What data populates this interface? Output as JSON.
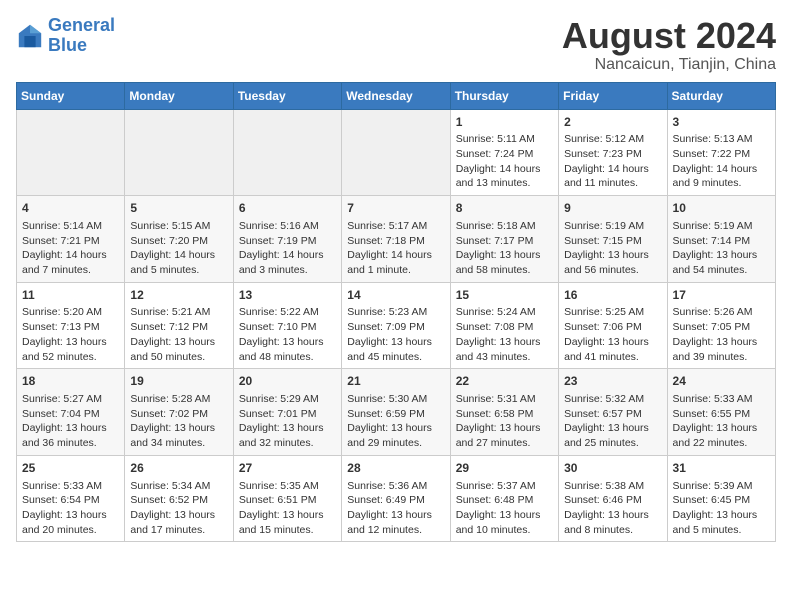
{
  "logo": {
    "text_general": "General",
    "text_blue": "Blue"
  },
  "title": "August 2024",
  "subtitle": "Nancaicun, Tianjin, China",
  "weekdays": [
    "Sunday",
    "Monday",
    "Tuesday",
    "Wednesday",
    "Thursday",
    "Friday",
    "Saturday"
  ],
  "weeks": [
    [
      {
        "day": "",
        "info": ""
      },
      {
        "day": "",
        "info": ""
      },
      {
        "day": "",
        "info": ""
      },
      {
        "day": "",
        "info": ""
      },
      {
        "day": "1",
        "info": "Sunrise: 5:11 AM\nSunset: 7:24 PM\nDaylight: 14 hours\nand 13 minutes."
      },
      {
        "day": "2",
        "info": "Sunrise: 5:12 AM\nSunset: 7:23 PM\nDaylight: 14 hours\nand 11 minutes."
      },
      {
        "day": "3",
        "info": "Sunrise: 5:13 AM\nSunset: 7:22 PM\nDaylight: 14 hours\nand 9 minutes."
      }
    ],
    [
      {
        "day": "4",
        "info": "Sunrise: 5:14 AM\nSunset: 7:21 PM\nDaylight: 14 hours\nand 7 minutes."
      },
      {
        "day": "5",
        "info": "Sunrise: 5:15 AM\nSunset: 7:20 PM\nDaylight: 14 hours\nand 5 minutes."
      },
      {
        "day": "6",
        "info": "Sunrise: 5:16 AM\nSunset: 7:19 PM\nDaylight: 14 hours\nand 3 minutes."
      },
      {
        "day": "7",
        "info": "Sunrise: 5:17 AM\nSunset: 7:18 PM\nDaylight: 14 hours\nand 1 minute."
      },
      {
        "day": "8",
        "info": "Sunrise: 5:18 AM\nSunset: 7:17 PM\nDaylight: 13 hours\nand 58 minutes."
      },
      {
        "day": "9",
        "info": "Sunrise: 5:19 AM\nSunset: 7:15 PM\nDaylight: 13 hours\nand 56 minutes."
      },
      {
        "day": "10",
        "info": "Sunrise: 5:19 AM\nSunset: 7:14 PM\nDaylight: 13 hours\nand 54 minutes."
      }
    ],
    [
      {
        "day": "11",
        "info": "Sunrise: 5:20 AM\nSunset: 7:13 PM\nDaylight: 13 hours\nand 52 minutes."
      },
      {
        "day": "12",
        "info": "Sunrise: 5:21 AM\nSunset: 7:12 PM\nDaylight: 13 hours\nand 50 minutes."
      },
      {
        "day": "13",
        "info": "Sunrise: 5:22 AM\nSunset: 7:10 PM\nDaylight: 13 hours\nand 48 minutes."
      },
      {
        "day": "14",
        "info": "Sunrise: 5:23 AM\nSunset: 7:09 PM\nDaylight: 13 hours\nand 45 minutes."
      },
      {
        "day": "15",
        "info": "Sunrise: 5:24 AM\nSunset: 7:08 PM\nDaylight: 13 hours\nand 43 minutes."
      },
      {
        "day": "16",
        "info": "Sunrise: 5:25 AM\nSunset: 7:06 PM\nDaylight: 13 hours\nand 41 minutes."
      },
      {
        "day": "17",
        "info": "Sunrise: 5:26 AM\nSunset: 7:05 PM\nDaylight: 13 hours\nand 39 minutes."
      }
    ],
    [
      {
        "day": "18",
        "info": "Sunrise: 5:27 AM\nSunset: 7:04 PM\nDaylight: 13 hours\nand 36 minutes."
      },
      {
        "day": "19",
        "info": "Sunrise: 5:28 AM\nSunset: 7:02 PM\nDaylight: 13 hours\nand 34 minutes."
      },
      {
        "day": "20",
        "info": "Sunrise: 5:29 AM\nSunset: 7:01 PM\nDaylight: 13 hours\nand 32 minutes."
      },
      {
        "day": "21",
        "info": "Sunrise: 5:30 AM\nSunset: 6:59 PM\nDaylight: 13 hours\nand 29 minutes."
      },
      {
        "day": "22",
        "info": "Sunrise: 5:31 AM\nSunset: 6:58 PM\nDaylight: 13 hours\nand 27 minutes."
      },
      {
        "day": "23",
        "info": "Sunrise: 5:32 AM\nSunset: 6:57 PM\nDaylight: 13 hours\nand 25 minutes."
      },
      {
        "day": "24",
        "info": "Sunrise: 5:33 AM\nSunset: 6:55 PM\nDaylight: 13 hours\nand 22 minutes."
      }
    ],
    [
      {
        "day": "25",
        "info": "Sunrise: 5:33 AM\nSunset: 6:54 PM\nDaylight: 13 hours\nand 20 minutes."
      },
      {
        "day": "26",
        "info": "Sunrise: 5:34 AM\nSunset: 6:52 PM\nDaylight: 13 hours\nand 17 minutes."
      },
      {
        "day": "27",
        "info": "Sunrise: 5:35 AM\nSunset: 6:51 PM\nDaylight: 13 hours\nand 15 minutes."
      },
      {
        "day": "28",
        "info": "Sunrise: 5:36 AM\nSunset: 6:49 PM\nDaylight: 13 hours\nand 12 minutes."
      },
      {
        "day": "29",
        "info": "Sunrise: 5:37 AM\nSunset: 6:48 PM\nDaylight: 13 hours\nand 10 minutes."
      },
      {
        "day": "30",
        "info": "Sunrise: 5:38 AM\nSunset: 6:46 PM\nDaylight: 13 hours\nand 8 minutes."
      },
      {
        "day": "31",
        "info": "Sunrise: 5:39 AM\nSunset: 6:45 PM\nDaylight: 13 hours\nand 5 minutes."
      }
    ]
  ]
}
